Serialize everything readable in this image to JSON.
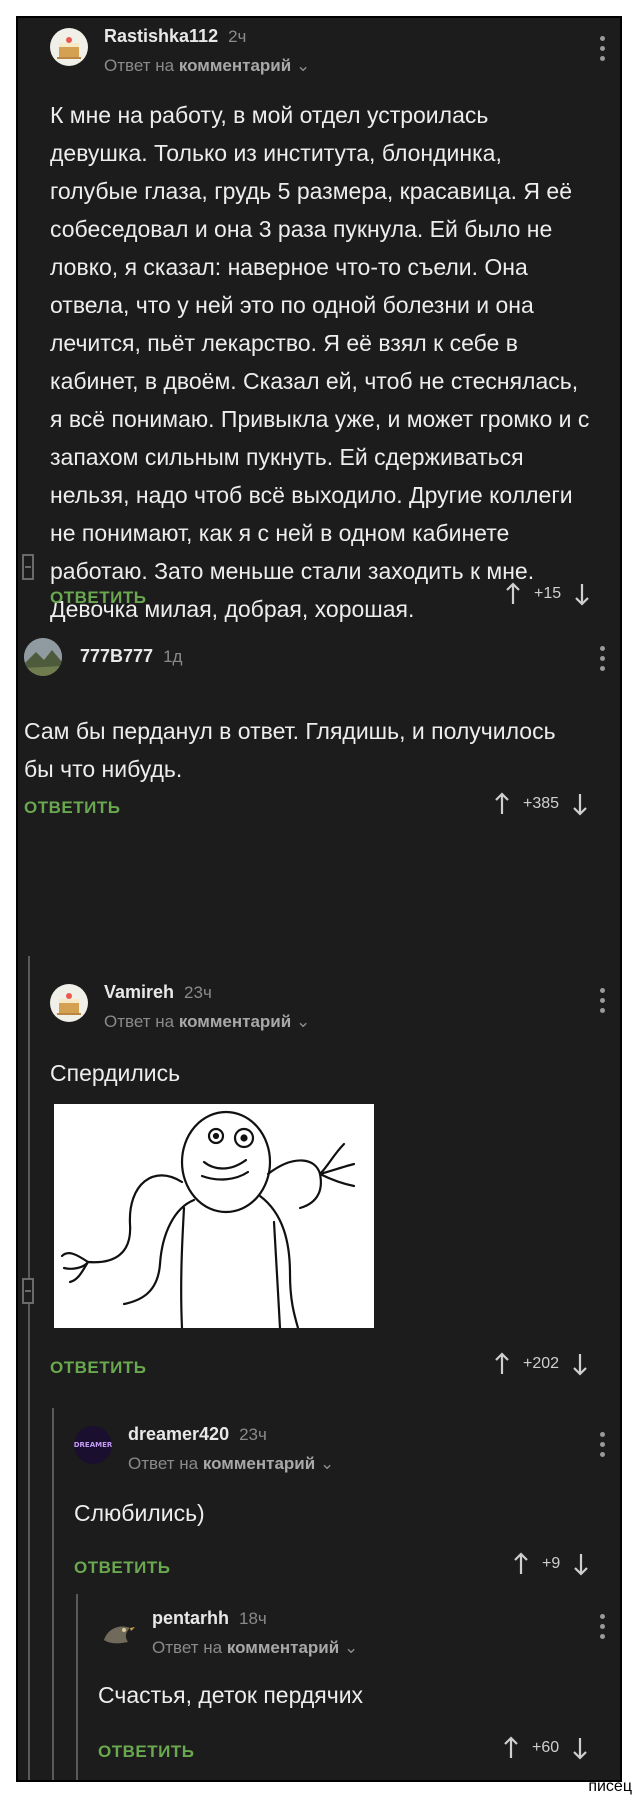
{
  "ui": {
    "reply_label": "ОТВЕТИТЬ",
    "reply_to_prefix": "Ответ на",
    "reply_to_target": "комментарий",
    "chevron": "⌄"
  },
  "comments": [
    {
      "author": "Rastishka112",
      "time": "2ч",
      "is_reply": true,
      "text": "К мне на работу, в мой отдел устроилась девушка. Только из института, блондинка, голубые глаза, грудь 5 размера, красавица. Я её собеседовал и она 3 раза пукнула. Ей было не ловко, я сказал: наверное что-то съели. Она отвела, что у ней это по одной болезни и она лечится, пьёт лекарство. Я её взял к себе в кабинет, в двоём. Сказал ей, чтоб не стеснялась, я всё понимаю. Привыкла уже, и может громко и с запахом сильным пукнуть. Ей сдерживаться нельзя, надо чтоб всё выходило. Другие коллеги не понимают, как я с ней в одном кабинете работаю. Зато меньше стали заходить к мне. Девочка милая, добрая, хорошая.",
      "score": "+15",
      "avatar_icon": "cake-avatar-icon"
    },
    {
      "author": "777B777",
      "time": "1д",
      "is_reply": false,
      "text": "Сам бы перданул в ответ. Глядишь, и получилось бы что нибудь.",
      "score": "+385",
      "avatar_icon": "landscape-avatar-icon"
    },
    {
      "author": "Vamireh",
      "time": "23ч",
      "is_reply": true,
      "text": "Спердились",
      "has_image": true,
      "score": "+202",
      "avatar_icon": "cake-avatar-icon"
    },
    {
      "author": "dreamer420",
      "time": "23ч",
      "is_reply": true,
      "text": "Слюбились)",
      "score": "+9",
      "avatar_icon": "dreamer-avatar-icon",
      "avatar_text": "DREAMER"
    },
    {
      "author": "pentarhh",
      "time": "18ч",
      "is_reply": true,
      "text": "Счастья, деток пердячих",
      "score": "+60",
      "avatar_icon": "bird-avatar-icon"
    }
  ],
  "watermark": "писец",
  "colors": {
    "background": "#1c1c1c",
    "text": "#ededed",
    "muted": "#8a8a8a",
    "reply_green": "#6aa84f"
  }
}
